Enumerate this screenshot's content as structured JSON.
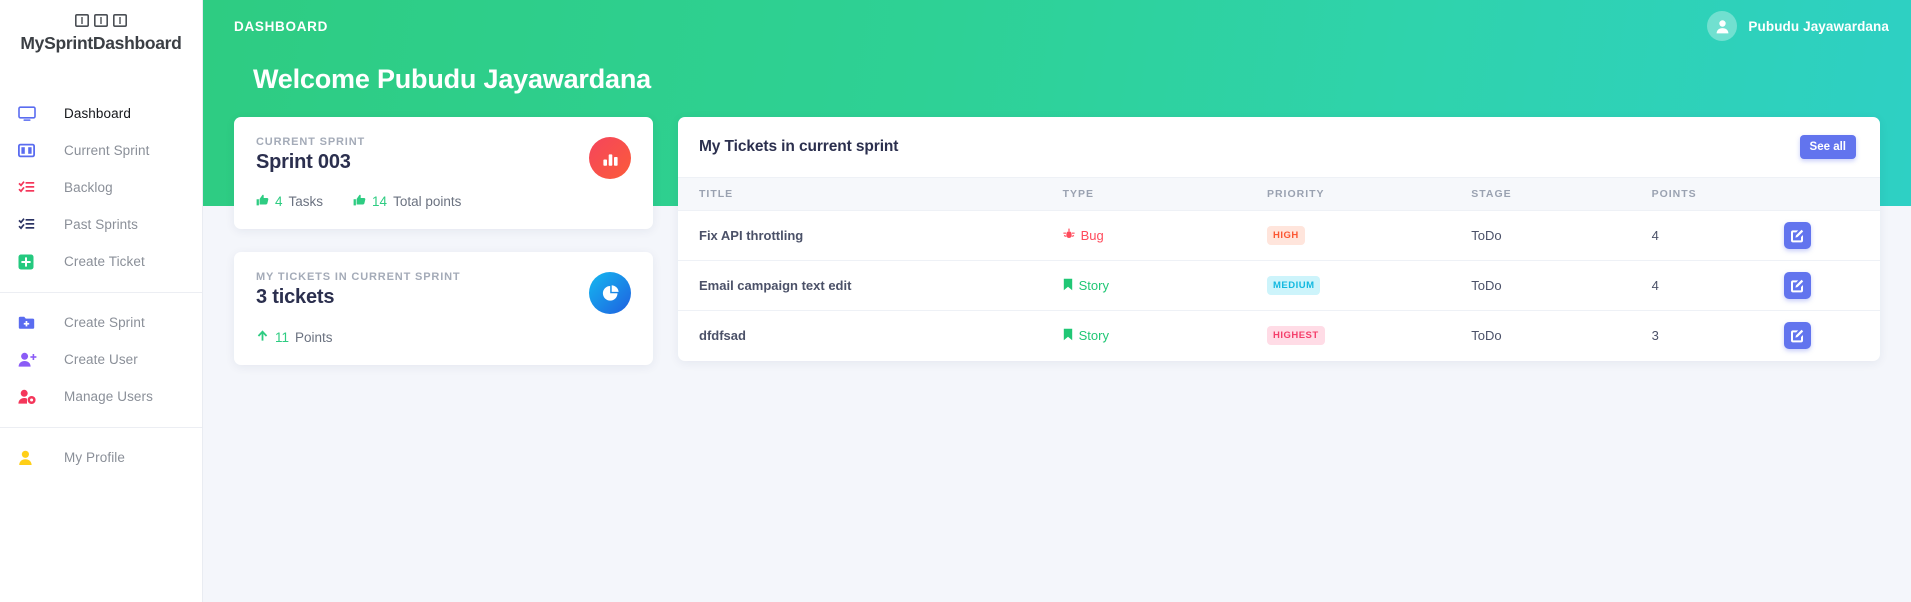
{
  "brand": {
    "name": "MySprintDashboard",
    "logo_icon": "board-columns-icon"
  },
  "sidebar": {
    "groups": [
      {
        "items": [
          {
            "label": "Dashboard",
            "icon": "monitor-icon",
            "active": true
          },
          {
            "label": "Current Sprint",
            "icon": "board-columns-icon",
            "active": false
          },
          {
            "label": "Backlog",
            "icon": "task-list-red-icon",
            "active": false
          },
          {
            "label": "Past Sprints",
            "icon": "task-list-dark-icon",
            "active": false
          },
          {
            "label": "Create Ticket",
            "icon": "plus-square-icon",
            "active": false
          }
        ]
      },
      {
        "items": [
          {
            "label": "Create Sprint",
            "icon": "folder-plus-icon",
            "active": false
          },
          {
            "label": "Create User",
            "icon": "user-plus-icon",
            "active": false
          },
          {
            "label": "Manage Users",
            "icon": "user-gear-icon",
            "active": false
          }
        ]
      },
      {
        "items": [
          {
            "label": "My Profile",
            "icon": "user-icon",
            "active": false
          }
        ]
      }
    ]
  },
  "header": {
    "breadcrumb": "DASHBOARD",
    "welcome": "Welcome Pubudu Jayawardana",
    "user_name": "Pubudu Jayawardana",
    "avatar_icon": "user-avatar-icon",
    "gradient_from": "#2ecc82",
    "gradient_to": "#2ed0c4"
  },
  "stat_cards": [
    {
      "kicker": "CURRENT SPRINT",
      "value": "Sprint 003",
      "badge_icon": "bar-chart-icon",
      "badge_color": "#f5455c",
      "metrics": [
        {
          "icon": "thumbs-up-icon",
          "number": "4",
          "label": "Tasks"
        },
        {
          "icon": "thumbs-up-icon",
          "number": "14",
          "label": "Total points"
        }
      ]
    },
    {
      "kicker": "MY TICKETS IN CURRENT SPRINT",
      "value": "3 tickets",
      "badge_icon": "pie-chart-icon",
      "badge_color": "#14b9f0",
      "metrics": [
        {
          "icon": "arrow-up-icon",
          "number": "11",
          "label": "Points"
        }
      ]
    }
  ],
  "tickets": {
    "title": "My Tickets in current sprint",
    "see_all_label": "See all",
    "columns": [
      "TITLE",
      "TYPE",
      "PRIORITY",
      "STAGE",
      "POINTS",
      ""
    ],
    "rows": [
      {
        "title": "Fix API throttling",
        "type": "Bug",
        "type_icon": "bug-icon",
        "priority": "HIGH",
        "priority_class": "pill-high",
        "stage": "ToDo",
        "points": "4",
        "action_icon": "edit-pen-square-icon"
      },
      {
        "title": "Email campaign text edit",
        "type": "Story",
        "type_icon": "bookmark-icon",
        "priority": "MEDIUM",
        "priority_class": "pill-medium",
        "stage": "ToDo",
        "points": "4",
        "action_icon": "edit-pen-square-icon"
      },
      {
        "title": "dfdfsad",
        "type": "Story",
        "type_icon": "bookmark-icon",
        "priority": "HIGHEST",
        "priority_class": "pill-highest",
        "stage": "ToDo",
        "points": "3",
        "action_icon": "edit-pen-square-icon"
      }
    ]
  }
}
